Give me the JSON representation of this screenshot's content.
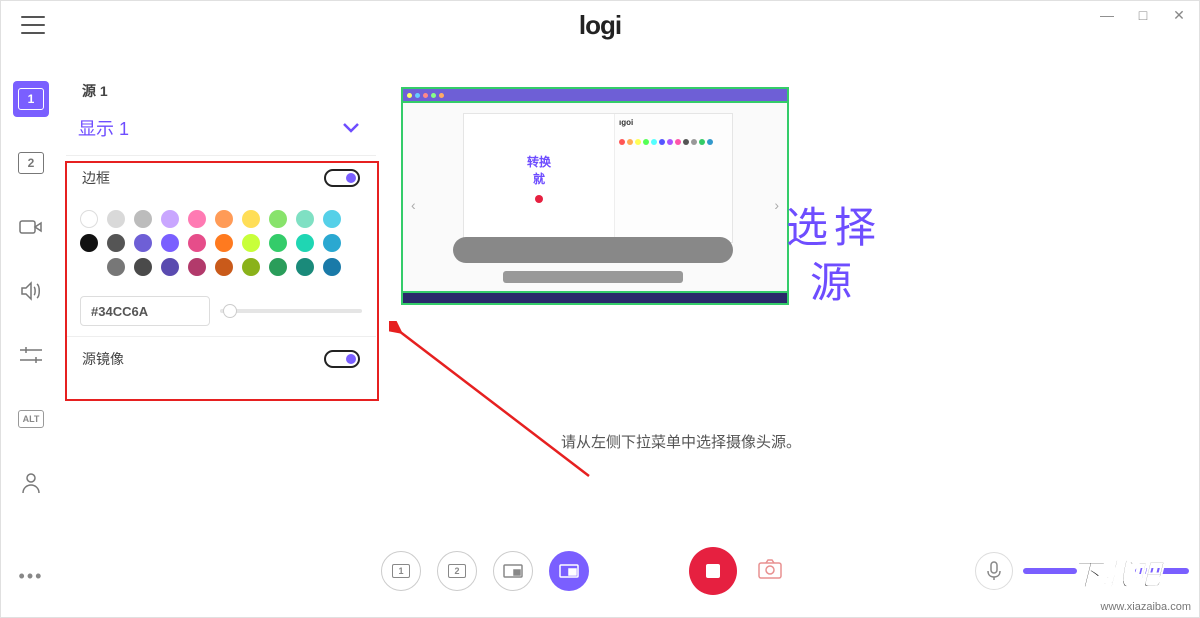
{
  "window": {
    "logo": "logi",
    "minimize": "—",
    "maximize": "□",
    "close": "✕"
  },
  "sidebar": {
    "items": [
      {
        "label": "1"
      },
      {
        "label": "2"
      },
      {
        "label": "camera"
      },
      {
        "label": "audio"
      },
      {
        "label": "layout"
      },
      {
        "label": "ALT"
      },
      {
        "label": "profile"
      }
    ]
  },
  "panel": {
    "source_label": "源 1",
    "display_label": "显示 1",
    "border_label": "边框",
    "mirror_label": "源镜像",
    "hex_value": "#34CC6A",
    "border_color": "#34CC6A",
    "accent": "#7a5fff"
  },
  "swatches": {
    "row1": [
      "#ffffff",
      "#d9d9d9",
      "#bcbcbc",
      "#c9a6ff",
      "#ff7ab3",
      "#ff9b57",
      "#ffde57",
      "#88e36b",
      "#7fe0c3",
      "#55d0e8"
    ],
    "row2": [
      "#111111",
      "#555555",
      "#6e5fd6",
      "#7a5fff",
      "#e64d8a",
      "#ff7a1f",
      "#c8ff3a",
      "#34cc6a",
      "#1fd6b3",
      "#2aa8d1"
    ],
    "row3": [
      "#777777",
      "#4a4a4a",
      "#5a4bb0",
      "#b23a6b",
      "#c95a1a",
      "#8ab21a",
      "#2a9d5a",
      "#1a8a7a",
      "#1a7aa8"
    ]
  },
  "preview": {
    "inner_text_1": "转换",
    "inner_text_2": "就"
  },
  "annotation": {
    "line1": "选择",
    "line2": "源"
  },
  "message": "请从左侧下拉菜单中选择摄像头源。",
  "bottombar": {
    "scene1": "1",
    "scene2": "2",
    "scene3": "⎚",
    "scene4": "⎚"
  },
  "watermark": {
    "brand": "下载吧",
    "url": "www.xiazaiba.com"
  }
}
